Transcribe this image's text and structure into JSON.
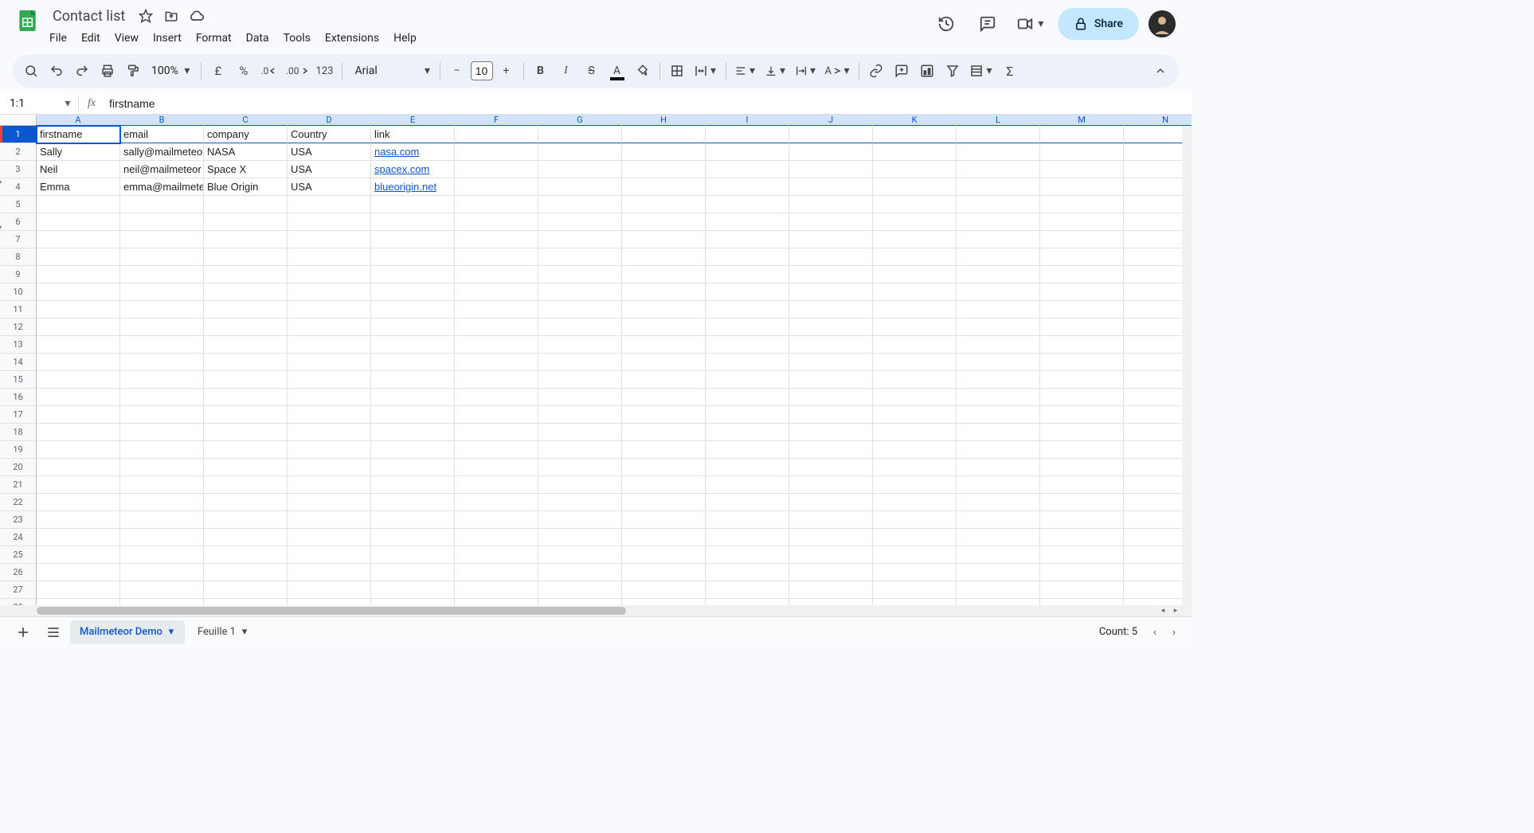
{
  "doc": {
    "title": "Contact list"
  },
  "menus": [
    "File",
    "Edit",
    "View",
    "Insert",
    "Format",
    "Data",
    "Tools",
    "Extensions",
    "Help"
  ],
  "share": {
    "label": "Share"
  },
  "toolbar": {
    "zoom": "100%",
    "font": "Arial",
    "font_size": "10"
  },
  "namebox": {
    "value": "1:1"
  },
  "formula_bar": {
    "value": "firstname"
  },
  "columns": [
    "A",
    "B",
    "C",
    "D",
    "E",
    "F",
    "G",
    "H",
    "I",
    "J",
    "K",
    "L",
    "M",
    "N"
  ],
  "row_count": 28,
  "selected_row": 1,
  "group_arrows": {
    "up_at": 4,
    "down_at": 6
  },
  "headers": [
    "firstname",
    "email",
    "company",
    "Country",
    "link"
  ],
  "rows": [
    {
      "firstname": "Sally",
      "email": "sally@mailmeteor",
      "company": "NASA",
      "Country": "USA",
      "link": "nasa.com"
    },
    {
      "firstname": "Neil",
      "email": "neil@mailmeteor",
      "company": "Space X",
      "Country": "USA",
      "link": "spacex.com"
    },
    {
      "firstname": "Emma",
      "email": "emma@mailmeteor",
      "company": "Blue Origin",
      "Country": "USA",
      "link": "blueorigin.net"
    }
  ],
  "sheets": {
    "tabs": [
      {
        "name": "Mailmeteor Demo",
        "active": true
      },
      {
        "name": "Feuille 1",
        "active": false
      }
    ]
  },
  "status": {
    "count_label": "Count: 5"
  }
}
